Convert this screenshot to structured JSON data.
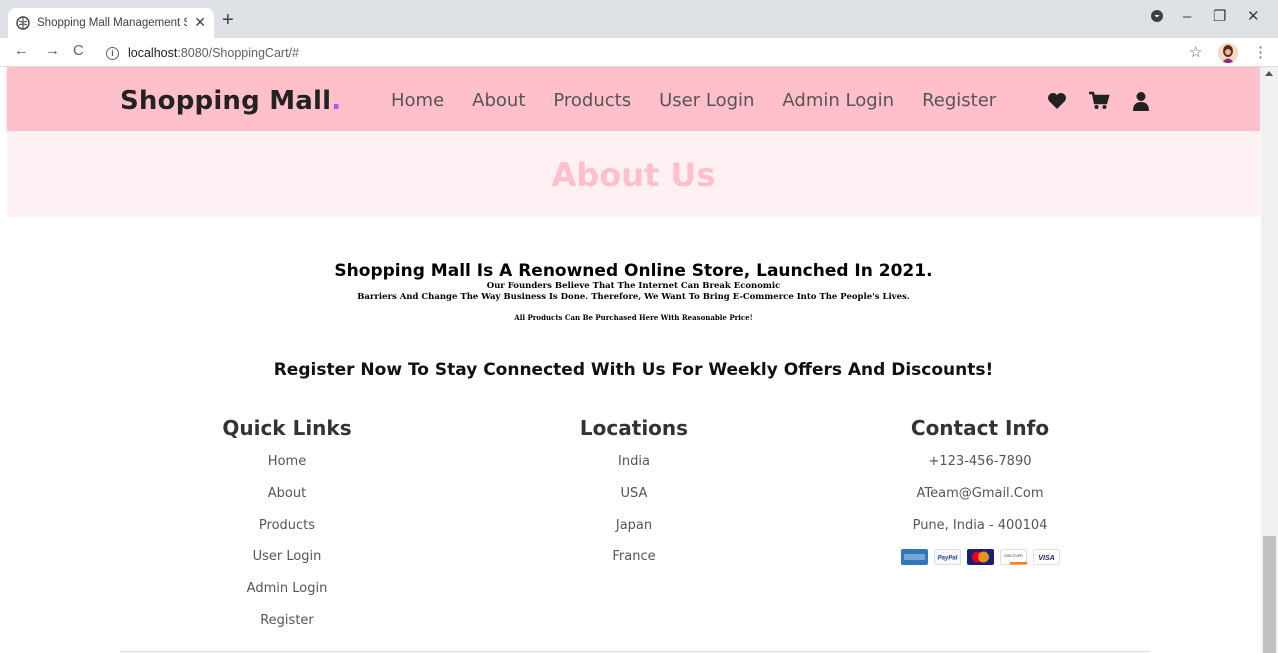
{
  "browser": {
    "tab_title": "Shopping Mall Management Sys",
    "url_host": "localhost",
    "url_path": ":8080/ShoppingCart/#"
  },
  "header": {
    "logo": "Shopping Mall",
    "logo_dot": ".",
    "nav": [
      "Home",
      "About",
      "Products",
      "User Login",
      "Admin Login",
      "Register"
    ]
  },
  "heading": "About Us",
  "about": {
    "line1": "Shopping Mall Is A Renowned Online Store, Launched In 2021.",
    "line2": "Our Founders Believe That The Internet Can Break Economic",
    "line3": "Barriers And Change The Way Business Is Done. Therefore, We Want To Bring E-Commerce Into The People's Lives.",
    "line4": "All Products Can Be Purchased Here With Reasonable Price!"
  },
  "register_line": "Register Now To Stay Connected With Us For Weekly Offers And Discounts!",
  "footer": {
    "quick_links": {
      "title": "Quick Links",
      "items": [
        "Home",
        "About",
        "Products",
        "User Login",
        "Admin Login",
        "Register"
      ]
    },
    "locations": {
      "title": "Locations",
      "items": [
        "India",
        "USA",
        "Japan",
        "France"
      ]
    },
    "contact": {
      "title": "Contact Info",
      "items": [
        "+123-456-7890",
        "ATeam@Gmail.Com",
        "Pune, India - 400104"
      ],
      "payment_icons": [
        "amex-card-icon",
        "paypal-card-icon",
        "mastercard-icon",
        "discover-card-icon",
        "visa-card-icon"
      ],
      "visa_label": "VISA",
      "paypal_label": "PayPal",
      "discover_label": "DISCOVER"
    }
  },
  "colors": {
    "header_bg": "#ffc0cb",
    "heading_band_bg": "#fff0f3",
    "logo_dot": "#a855f7"
  }
}
